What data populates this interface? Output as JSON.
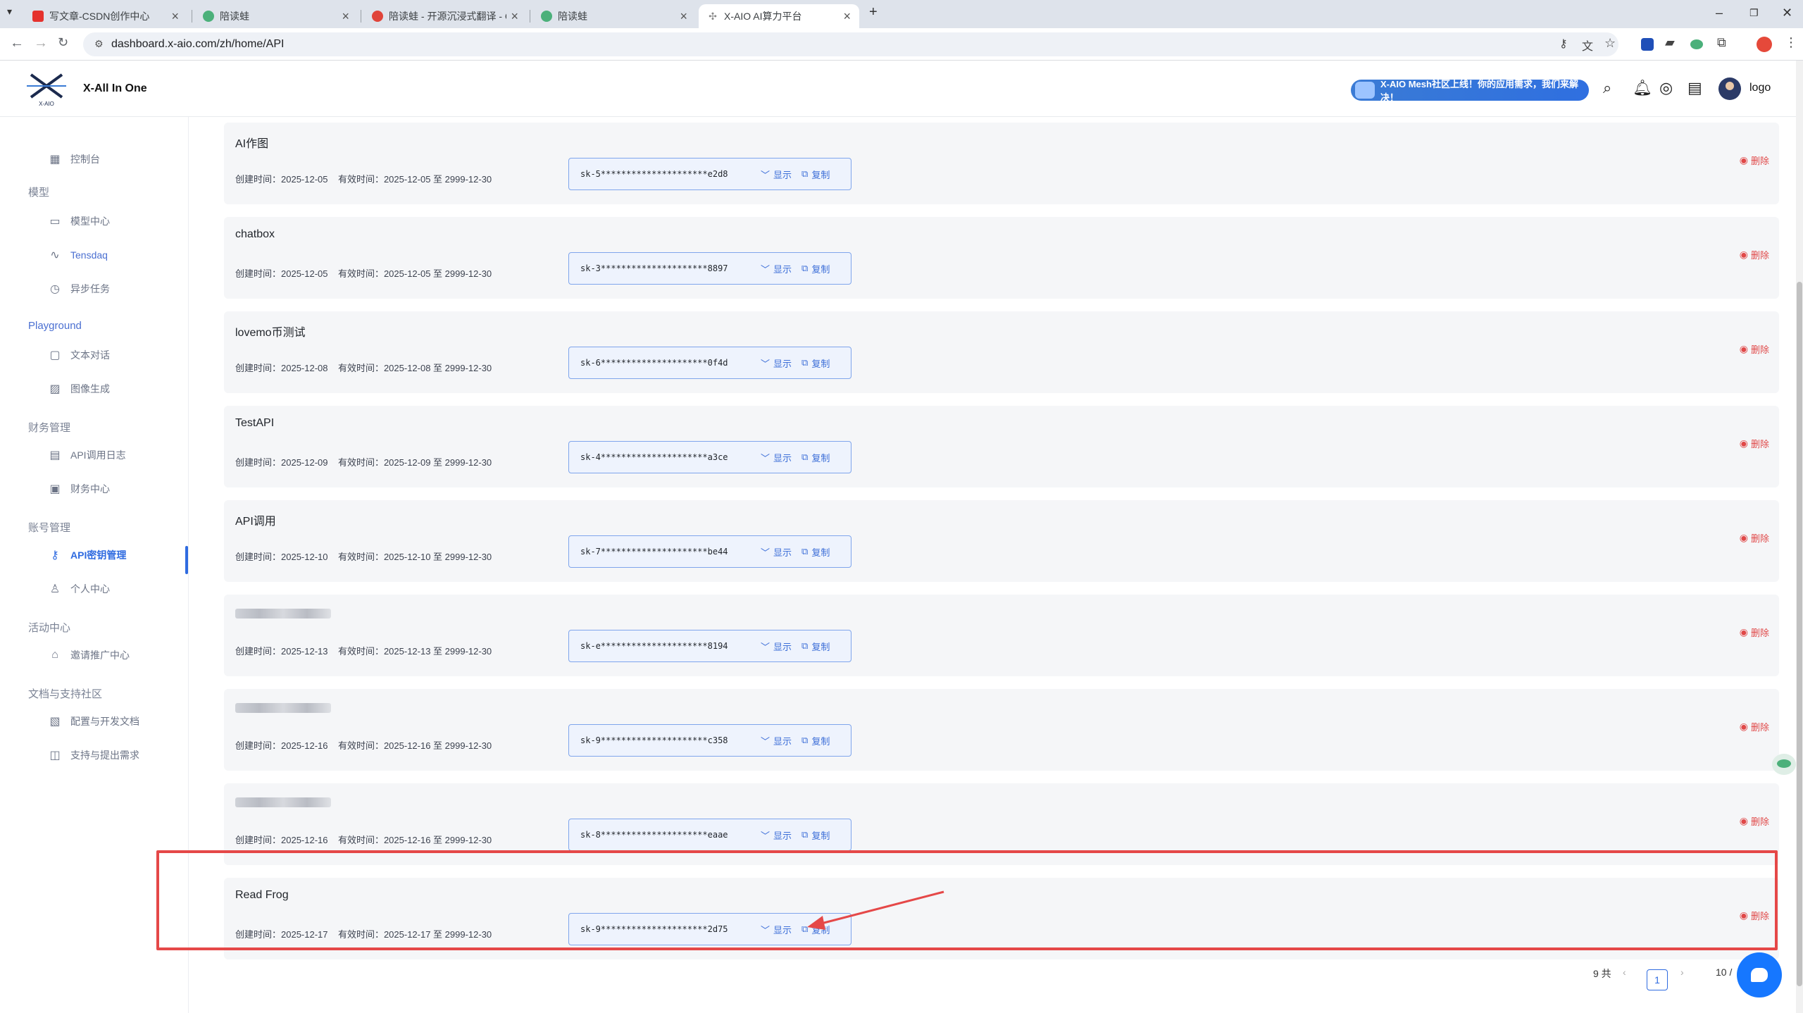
{
  "browser": {
    "tabs": [
      {
        "title": "写文章-CSDN创作中心",
        "favicon_color": "#e5322d"
      },
      {
        "title": "陪读蛙",
        "favicon_color": "#4bb07a"
      },
      {
        "title": "陪读蛙 - 开源沉浸式翻译 - Chr",
        "favicon_color": "#e0443a"
      },
      {
        "title": "陪读蛙",
        "favicon_color": "#4bb07a"
      },
      {
        "title": "X-AIO AI算力平台",
        "favicon_color": "#888888"
      }
    ],
    "url": "dashboard.x-aio.com/zh/home/API"
  },
  "header": {
    "logo_text": "X-AIO",
    "brand": "X-All In One",
    "banner": "X-AIO Mesh社区上线！你的应用需求，我们来解决！",
    "username": "logo"
  },
  "sidebar": {
    "dashboard": "控制台",
    "group_model": "模型",
    "model_center": "模型中心",
    "tensdaq": "Tensdaq",
    "async_tasks": "异步任务",
    "group_playground": "Playground",
    "text_chat": "文本对话",
    "image_gen": "图像生成",
    "group_finance": "财务管理",
    "api_logs": "API调用日志",
    "finance_center": "财务中心",
    "group_account": "账号管理",
    "api_keys": "API密钥管理",
    "profile": "个人中心",
    "group_activity": "活动中心",
    "referral": "邀请推广中心",
    "group_docs": "文档与支持社区",
    "config_docs": "配置与开发文档",
    "support": "支持与提出需求"
  },
  "labels": {
    "show": "显示",
    "copy": "复制",
    "delete": "删除"
  },
  "api_keys": [
    {
      "name": "AI作图",
      "meta": "创建时间：2025-12-05    有效时间：2025-12-05 至 2999-12-30",
      "key": "sk-5*********************e2d8"
    },
    {
      "name": "chatbox",
      "meta": "创建时间：2025-12-05    有效时间：2025-12-05 至 2999-12-30",
      "key": "sk-3*********************8897"
    },
    {
      "name": "lovemo币测试",
      "meta": "创建时间：2025-12-08    有效时间：2025-12-08 至 2999-12-30",
      "key": "sk-6*********************0f4d"
    },
    {
      "name": "TestAPI",
      "meta": "创建时间：2025-12-09    有效时间：2025-12-09 至 2999-12-30",
      "key": "sk-4*********************a3ce"
    },
    {
      "name": "API调用",
      "meta": "创建时间：2025-12-10    有效时间：2025-12-10 至 2999-12-30",
      "key": "sk-7*********************be44"
    },
    {
      "name": "",
      "meta": "创建时间：2025-12-13    有效时间：2025-12-13 至 2999-12-30",
      "key": "sk-e*********************8194"
    },
    {
      "name": "",
      "meta": "创建时间：2025-12-16    有效时间：2025-12-16 至 2999-12-30",
      "key": "sk-9*********************c358"
    },
    {
      "name": "",
      "meta": "创建时间：2025-12-16    有效时间：2025-12-16 至 2999-12-30",
      "key": "sk-8*********************eaae"
    },
    {
      "name": "Read Frog",
      "meta": "创建时间：2025-12-17    有效时间：2025-12-17 至 2999-12-30",
      "key": "sk-9*********************2d75"
    }
  ],
  "pagination": {
    "total": "9 共",
    "current_page": "1",
    "page_size": "10 /"
  },
  "colors": {
    "accent": "#2f6be0",
    "danger": "#e04848",
    "highlight": "#e54848"
  }
}
